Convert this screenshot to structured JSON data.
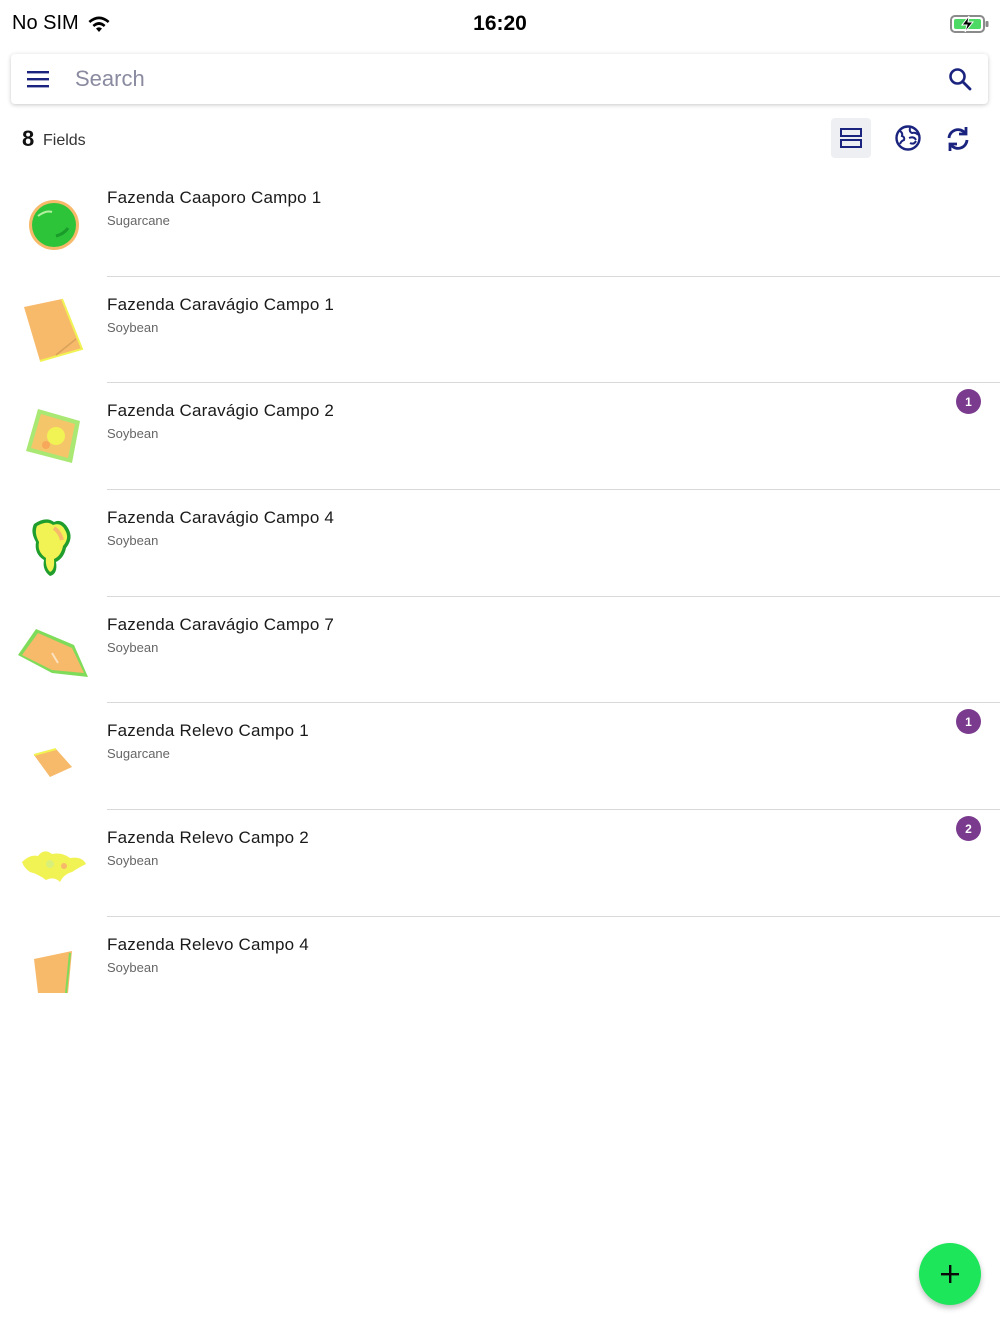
{
  "status_bar": {
    "carrier": "No SIM",
    "time": "16:20"
  },
  "search": {
    "placeholder": "Search",
    "value": ""
  },
  "summary": {
    "count": "8",
    "label": "Fields"
  },
  "colors": {
    "accent": "#1a237e",
    "badge": "#7a3b8f",
    "fab": "#1ee65a",
    "field_orange": "#f7b96a",
    "field_green": "#2ec43a",
    "field_yellow": "#f1f253"
  },
  "fields": [
    {
      "name": "Fazenda Caaporo Campo 1",
      "crop": "Sugarcane",
      "badge": "",
      "thumb_icon": "field-circle-green"
    },
    {
      "name": "Fazenda Caravágio Campo 1",
      "crop": "Soybean",
      "badge": "",
      "thumb_icon": "field-orange-rect"
    },
    {
      "name": "Fazenda Caravágio Campo 2",
      "crop": "Soybean",
      "badge": "1",
      "thumb_icon": "field-mixed-square"
    },
    {
      "name": "Fazenda Caravágio Campo 4",
      "crop": "Soybean",
      "badge": "",
      "thumb_icon": "field-irregular-yellow"
    },
    {
      "name": "Fazenda Caravágio Campo 7",
      "crop": "Soybean",
      "badge": "",
      "thumb_icon": "field-orange-diamond"
    },
    {
      "name": "Fazenda Relevo Campo 1",
      "crop": "Sugarcane",
      "badge": "1",
      "thumb_icon": "field-small-orange"
    },
    {
      "name": "Fazenda Relevo Campo 2",
      "crop": "Soybean",
      "badge": "2",
      "thumb_icon": "field-yellow-blob"
    },
    {
      "name": "Fazenda Relevo Campo 4",
      "crop": "Soybean",
      "badge": "",
      "thumb_icon": "field-orange-quad"
    }
  ],
  "icons": {
    "menu": "menu-icon",
    "search": "search-icon",
    "view_toggle": "list-view-icon",
    "globe": "globe-sync-icon",
    "sync": "sync-icon",
    "add": "add-icon"
  }
}
